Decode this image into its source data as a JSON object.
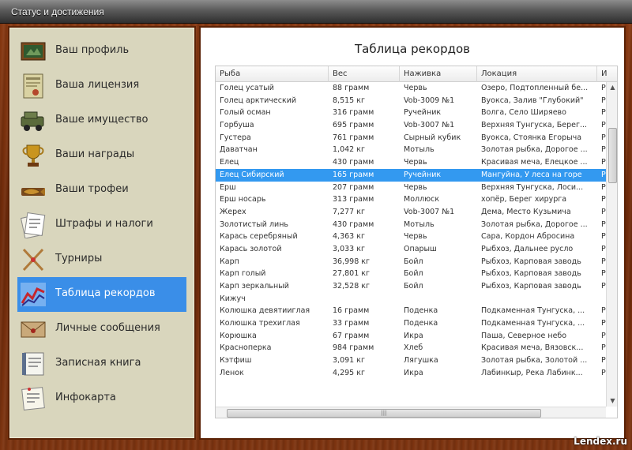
{
  "window": {
    "title": "Статус и достижения"
  },
  "sidebar": {
    "items": [
      {
        "label": "Ваш профиль",
        "icon": "profile-icon"
      },
      {
        "label": "Ваша лицензия",
        "icon": "license-icon"
      },
      {
        "label": "Ваше имущество",
        "icon": "property-icon"
      },
      {
        "label": "Ваши награды",
        "icon": "trophy-cup-icon"
      },
      {
        "label": "Ваши трофеи",
        "icon": "fish-trophy-icon"
      },
      {
        "label": "Штрафы и налоги",
        "icon": "fines-icon"
      },
      {
        "label": "Турниры",
        "icon": "tournament-icon"
      },
      {
        "label": "Таблица рекордов",
        "icon": "records-chart-icon"
      },
      {
        "label": "Личные сообщения",
        "icon": "letter-icon"
      },
      {
        "label": "Записная книга",
        "icon": "notebook-icon"
      },
      {
        "label": "Инфокарта",
        "icon": "infocard-icon"
      }
    ],
    "active_index": 7
  },
  "main": {
    "heading": "Таблица рекордов",
    "columns": [
      "Рыба",
      "Вес",
      "Наживка",
      "Локация",
      "И"
    ],
    "selected_row": 7,
    "rows": [
      [
        "Голец усатый",
        "88 грамм",
        "Червь",
        "Озеро, Подтопленный бе...",
        "Р"
      ],
      [
        "Голец арктический",
        "8,515 кг",
        "Vob-3009 №1",
        "Вуокса, Залив \"Глубокий\"",
        "Р"
      ],
      [
        "Голый осман",
        "316 грамм",
        "Ручейник",
        "Волга, Село Ширяево",
        "Р"
      ],
      [
        "Горбуша",
        "695 грамм",
        "Vob-3007 №1",
        "Верхняя Тунгуска, Берег...",
        "Р"
      ],
      [
        "Густера",
        "761 грамм",
        "Сырный кубик",
        "Вуокса, Стоянка Егорыча",
        "Р"
      ],
      [
        "Даватчан",
        "1,042 кг",
        "Мотыль",
        "Золотая рыбка, Дорогое ...",
        "Р"
      ],
      [
        "Елец",
        "430 грамм",
        "Червь",
        "Красивая меча, Елецкое ...",
        "Р"
      ],
      [
        "Елец Сибирский",
        "165 грамм",
        "Ручейник",
        "Мангуйна, У леса на горе",
        "Р"
      ],
      [
        "Ерш",
        "207 грамм",
        "Червь",
        "Верхняя Тунгуска, Лоси...",
        "Р"
      ],
      [
        "Ерш носарь",
        "313 грамм",
        "Моллюск",
        "хопёр, Берег хирурга",
        "Р"
      ],
      [
        "Жерех",
        "7,277 кг",
        "Vob-3007 №1",
        "Дема, Место Кузьмича",
        "Р"
      ],
      [
        "Золотистый линь",
        "430 грамм",
        "Мотыль",
        "Золотая рыбка, Дорогое ...",
        "Р"
      ],
      [
        "Карась серебряный",
        "4,363 кг",
        "Червь",
        "Сара, Кордон Абросина",
        "Р"
      ],
      [
        "Карась золотой",
        "3,033 кг",
        "Опарыш",
        "Рыбхоз, Дальнее русло",
        "Р"
      ],
      [
        "Карп",
        "36,998 кг",
        "Бойл",
        "Рыбхоз, Карповая заводь",
        "Р"
      ],
      [
        "Карп голый",
        "27,801 кг",
        "Бойл",
        "Рыбхоз, Карповая заводь",
        "Р"
      ],
      [
        "Карп зеркальный",
        "32,528 кг",
        "Бойл",
        "Рыбхоз, Карповая заводь",
        "Р"
      ],
      [
        "Кижуч",
        "",
        "",
        "",
        ""
      ],
      [
        "Колюшка девятииглая",
        "16 грамм",
        "Поденка",
        "Подкаменная Тунгуска, ...",
        "Р"
      ],
      [
        "Колюшка трехиглая",
        "33 грамм",
        "Поденка",
        "Подкаменная Тунгуска, ...",
        "Р"
      ],
      [
        "Корюшка",
        "67 грамм",
        "Икра",
        "Паша, Северное небо",
        "Р"
      ],
      [
        "Красноперка",
        "984 грамм",
        "Хлеб",
        "Красивая меча, Вязовск...",
        "Р"
      ],
      [
        "Кэтфиш",
        "3,091 кг",
        "Лягушка",
        "Золотая рыбка, Золотой ...",
        "Р"
      ],
      [
        "Ленок",
        "4,295 кг",
        "Икра",
        "Лабинкыр, Река Лабинк...",
        "Р"
      ]
    ]
  },
  "watermark": "Lendex.ru",
  "colors": {
    "selection": "#3399f0",
    "active_nav": "#3a8ee8",
    "wood": "#7a300e"
  }
}
